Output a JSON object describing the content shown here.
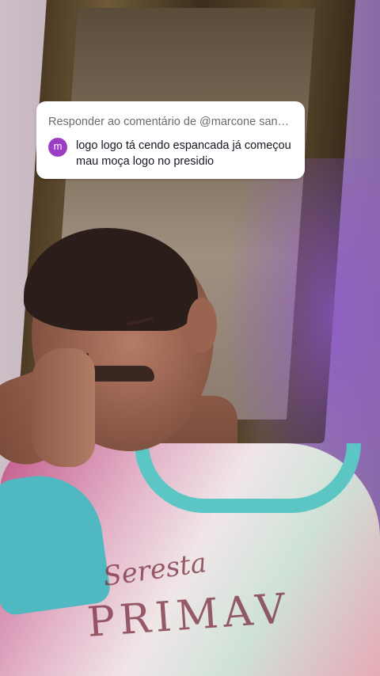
{
  "reply": {
    "header": "Responder ao comentário de @marcone san…",
    "avatar_letter": "m",
    "avatar_color": "#9c3ec4",
    "comment": "logo logo tá cendo espancada já começou mau moça logo no presidio"
  },
  "shirt_print": {
    "line1": "Seresta",
    "line2": "PRIMAV"
  }
}
